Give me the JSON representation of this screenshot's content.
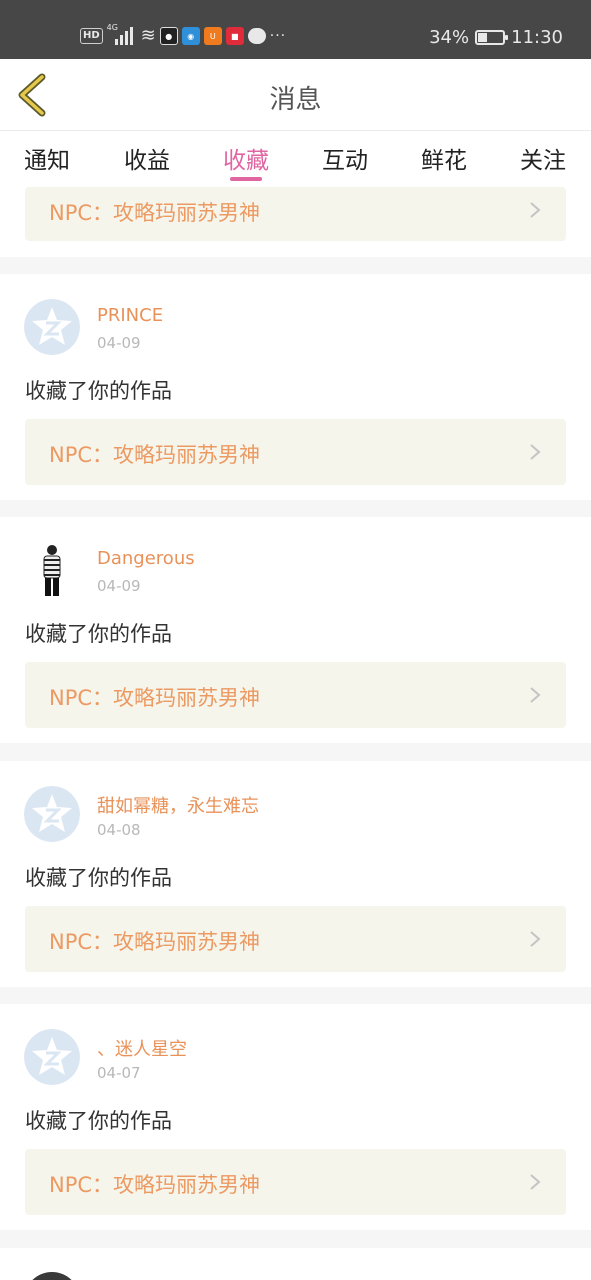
{
  "status_bar": {
    "hd": "HD",
    "network": "4G",
    "battery_text": "34%",
    "battery_level": 0.34,
    "time": "11:30",
    "icons": [
      "hd-icon",
      "signal-icon",
      "wifi-icon",
      "app-notification-icons",
      "chat-icon",
      "more-dots-icon"
    ]
  },
  "header": {
    "title": "消息",
    "back_icon": "back-chevron-icon",
    "accent": "#e6c84a"
  },
  "tabs": [
    {
      "label": "通知"
    },
    {
      "label": "收益"
    },
    {
      "label": "收藏",
      "active": true
    },
    {
      "label": "互动"
    },
    {
      "label": "鲜花"
    },
    {
      "label": "关注"
    }
  ],
  "top_partial": {
    "work_title": "NPC：攻略玛丽苏男神"
  },
  "items": [
    {
      "avatar": "default-star-avatar",
      "name": "PRINCE",
      "date": "04-09",
      "action": "收藏了你的作品",
      "work_title": "NPC：攻略玛丽苏男神"
    },
    {
      "avatar": "photo-avatar",
      "name": "Dangerous",
      "date": "04-09",
      "action": "收藏了你的作品",
      "work_title": "NPC：攻略玛丽苏男神"
    },
    {
      "avatar": "default-star-avatar",
      "name": "甜如幂糖，永生难忘",
      "date": "04-08",
      "action": "收藏了你的作品",
      "work_title": "NPC：攻略玛丽苏男神"
    },
    {
      "avatar": "default-star-avatar",
      "name": "、迷人星空",
      "date": "04-07",
      "action": "收藏了你的作品",
      "work_title": "NPC：攻略玛丽苏男神"
    }
  ],
  "colors": {
    "accent_pink": "#e066a2",
    "name_orange": "#e8925a",
    "work_bg": "#f5f5ec"
  }
}
